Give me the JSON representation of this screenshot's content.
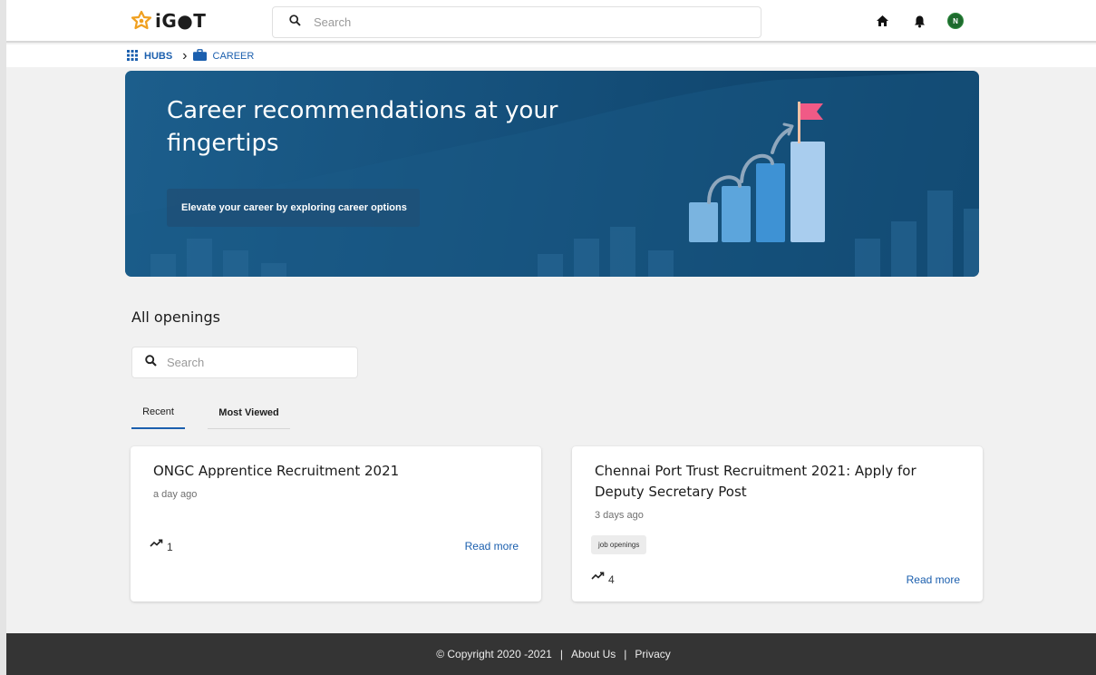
{
  "header": {
    "logo_text": "iG●T",
    "search_placeholder": "Search",
    "avatar_initial": "N"
  },
  "breadcrumb": {
    "hubs_label": "HUBS",
    "career_label": "CAREER"
  },
  "banner": {
    "title": "Career recommendations at your fingertips",
    "subtitle": "Elevate your career by exploring career options"
  },
  "openings": {
    "title": "All openings",
    "search_placeholder": "Search",
    "tabs": [
      {
        "label": "Recent",
        "active": true
      },
      {
        "label": "Most Viewed",
        "active": false
      }
    ],
    "cards": [
      {
        "title": "ONGC Apprentice Recruitment 2021",
        "time": "a day ago",
        "tag": "",
        "count": "1",
        "read_more": "Read more"
      },
      {
        "title": "Chennai Port Trust Recruitment 2021: Apply for Deputy Secretary Post",
        "time": "3 days ago",
        "tag": "job openings",
        "count": "4",
        "read_more": "Read more"
      }
    ]
  },
  "footer": {
    "copyright": "© Copyright 2020 -2021",
    "sep1": "|",
    "about": "About Us",
    "sep2": "|",
    "privacy": "Privacy"
  },
  "colors": {
    "accent": "#1b5fae",
    "banner_dark": "#0c3e64",
    "footer_bg": "#343434",
    "avatar_bg": "#1e6b2e",
    "flag": "#f05a86"
  },
  "icons": [
    "igot-logo-icon",
    "search-icon",
    "home-icon",
    "bell-icon",
    "apps-grid-icon",
    "briefcase-icon",
    "trending-up-icon"
  ]
}
